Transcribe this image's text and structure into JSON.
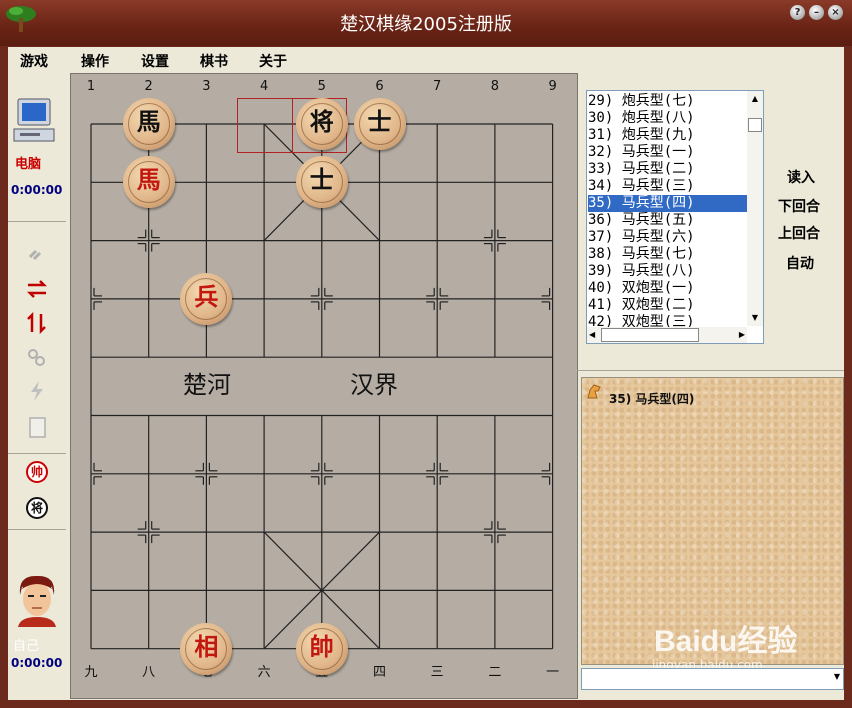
{
  "window": {
    "title": "楚汉棋缘2005注册版",
    "help_label": "?"
  },
  "menu": [
    "游戏",
    "操作",
    "设置",
    "棋书",
    "关于"
  ],
  "players": {
    "top": {
      "name": "电脑",
      "time": "0:00:00",
      "icon": "computer-icon"
    },
    "bottom": {
      "name": "自己",
      "time": "0:00:00",
      "icon": "avatar-icon"
    }
  },
  "tools": [
    "link-icon",
    "swap-icon",
    "flip-icon",
    "chain-icon",
    "lightning-icon",
    "book-icon"
  ],
  "side_badges": [
    "帅",
    "将"
  ],
  "board": {
    "top_columns": [
      "1",
      "2",
      "3",
      "4",
      "5",
      "6",
      "7",
      "8",
      "9"
    ],
    "bottom_columns": [
      "九",
      "八",
      "七",
      "六",
      "五",
      "四",
      "三",
      "二",
      "一"
    ],
    "river_left": "楚河",
    "river_right": "汉界",
    "pieces": [
      {
        "label": "馬",
        "color": "black",
        "col": 2,
        "row": 1
      },
      {
        "label": "将",
        "color": "black",
        "col": 5,
        "row": 1
      },
      {
        "label": "士",
        "color": "black",
        "col": 6,
        "row": 1
      },
      {
        "label": "馬",
        "color": "red",
        "col": 2,
        "row": 2
      },
      {
        "label": "士",
        "color": "black",
        "col": 5,
        "row": 2
      },
      {
        "label": "兵",
        "color": "red",
        "col": 3,
        "row": 4
      },
      {
        "label": "相",
        "color": "red",
        "col": 3,
        "row": 10
      },
      {
        "label": "帥",
        "color": "red",
        "col": 5,
        "row": 10
      }
    ]
  },
  "book_list": {
    "items": [
      "29) 炮兵型(七)",
      "30) 炮兵型(八)",
      "31) 炮兵型(九)",
      "32) 马兵型(一)",
      "33) 马兵型(二)",
      "34) 马兵型(三)",
      "35) 马兵型(四)",
      "36) 马兵型(五)",
      "37) 马兵型(六)",
      "38) 马兵型(七)",
      "39) 马兵型(八)",
      "40) 双炮型(一)",
      "41) 双炮型(二)",
      "42) 双炮型(三)"
    ],
    "selected_index": 6
  },
  "right_buttons": [
    "读入",
    "下回合",
    "上回合",
    "自动"
  ],
  "info": {
    "title": "35) 马兵型(四)"
  },
  "watermark": {
    "logo": "Baidu经验",
    "url": "jingyan.baidu.com"
  }
}
